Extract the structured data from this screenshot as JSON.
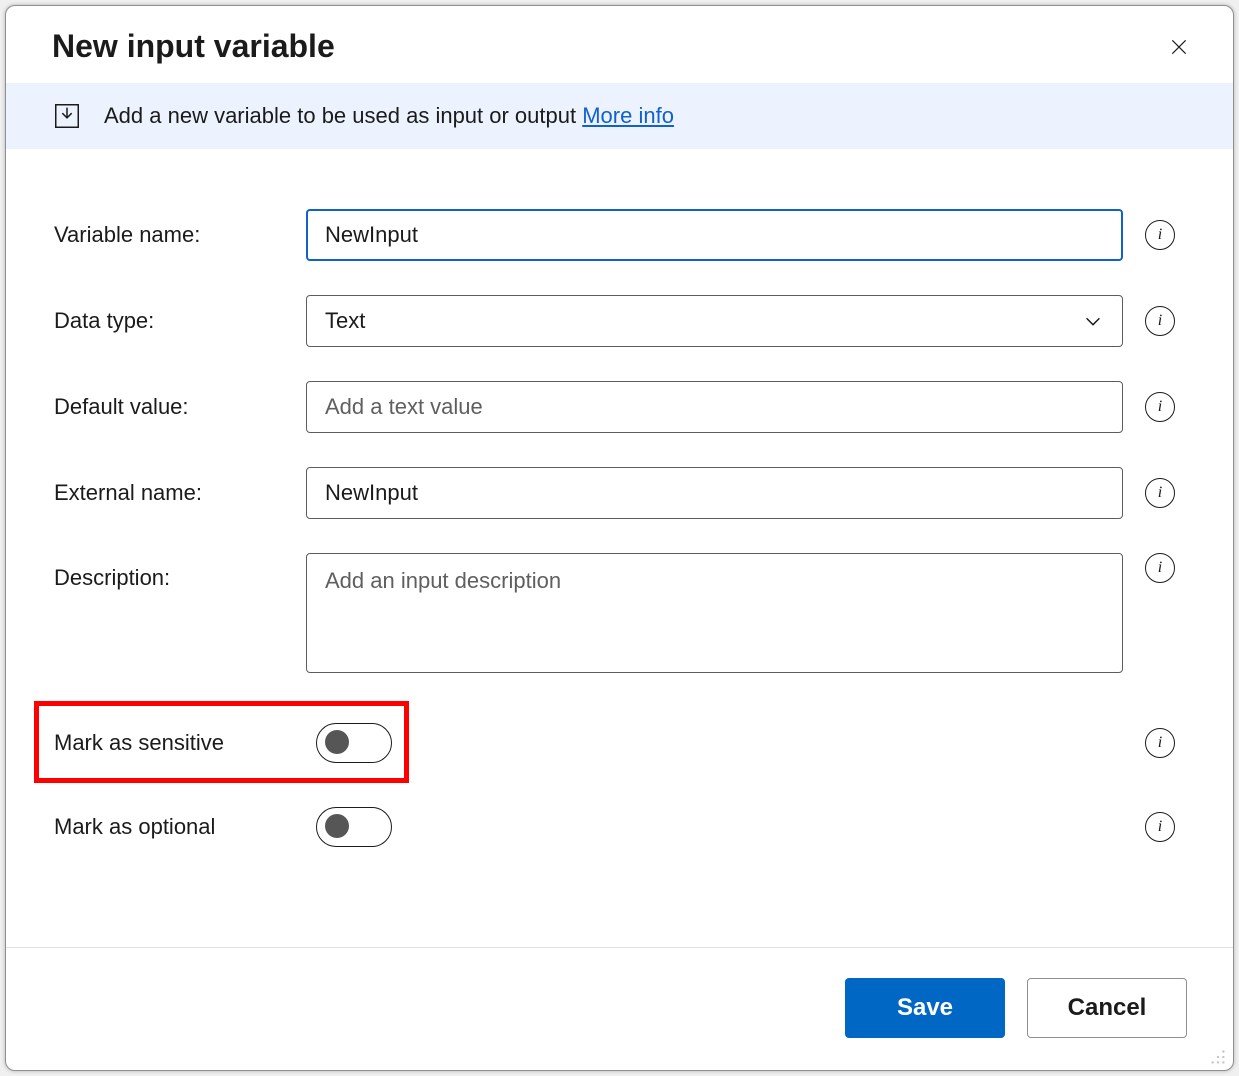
{
  "dialog": {
    "title": "New input variable",
    "banner_text": "Add a new variable to be used as input or output ",
    "more_info_label": "More info"
  },
  "form": {
    "variable_name": {
      "label": "Variable name:",
      "value": "NewInput"
    },
    "data_type": {
      "label": "Data type:",
      "value": "Text"
    },
    "default_value": {
      "label": "Default value:",
      "value": "",
      "placeholder": "Add a text value"
    },
    "external_name": {
      "label": "External name:",
      "value": "NewInput"
    },
    "description": {
      "label": "Description:",
      "value": "",
      "placeholder": "Add an input description"
    },
    "sensitive": {
      "label": "Mark as sensitive",
      "value": false
    },
    "optional": {
      "label": "Mark as optional",
      "value": false
    }
  },
  "footer": {
    "save_label": "Save",
    "cancel_label": "Cancel"
  }
}
